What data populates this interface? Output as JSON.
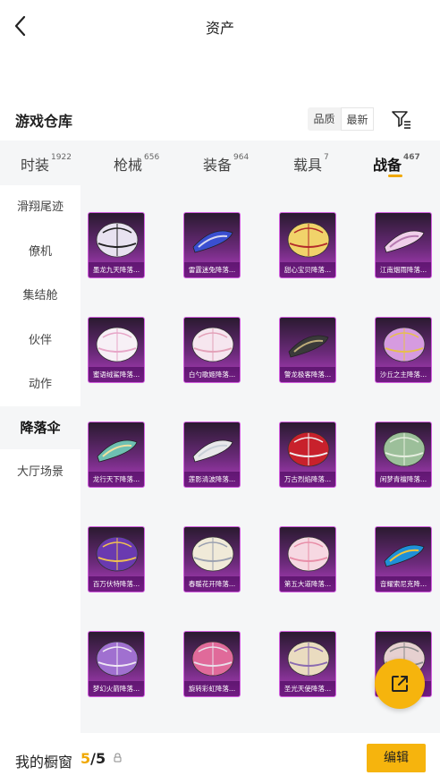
{
  "header": {
    "title": "资产"
  },
  "warehouse": {
    "title": "游戏仓库",
    "sort": [
      "品质",
      "最新"
    ],
    "sort_active": "最新"
  },
  "tabs": [
    {
      "label": "时装",
      "count": "1922"
    },
    {
      "label": "枪械",
      "count": "656"
    },
    {
      "label": "装备",
      "count": "964"
    },
    {
      "label": "载具",
      "count": "7"
    },
    {
      "label": "战备",
      "count": "467"
    }
  ],
  "active_tab": "战备",
  "sidebar": [
    {
      "label": "滑翔尾迹"
    },
    {
      "label": "僚机"
    },
    {
      "label": "集结舱"
    },
    {
      "label": "伙伴"
    },
    {
      "label": "动作"
    },
    {
      "label": "降落伞"
    },
    {
      "label": "大厅场景"
    }
  ],
  "active_sidebar": "降落伞",
  "items": [
    {
      "name": "墨龙九天降落..."
    },
    {
      "name": "雷霆迷兔降落..."
    },
    {
      "name": "甜心宝贝降落..."
    },
    {
      "name": "江南烟雨降落..."
    },
    {
      "name": "蜜语绒鲨降落..."
    },
    {
      "name": "白勺歌姬降落..."
    },
    {
      "name": "警龙极客降落..."
    },
    {
      "name": "沙丘之主降落..."
    },
    {
      "name": "龙行天下降落..."
    },
    {
      "name": "莲影清波降落..."
    },
    {
      "name": "万古烈焰降落..."
    },
    {
      "name": "闲梦青檀降落..."
    },
    {
      "name": "百万伏特降落..."
    },
    {
      "name": "春暖花开降落..."
    },
    {
      "name": "第五大道降落..."
    },
    {
      "name": "音耀索尼克降..."
    },
    {
      "name": "梦幻火箭降落..."
    },
    {
      "name": "旋转彩虹降落..."
    },
    {
      "name": "圣光天使降落..."
    },
    {
      "name": ""
    }
  ],
  "bottom": {
    "label": "我的橱窗",
    "current": "5",
    "total": "/5",
    "edit_label": "编辑"
  },
  "colors": {
    "accent": "#f6b40d",
    "card_border": "#d35fe0"
  }
}
